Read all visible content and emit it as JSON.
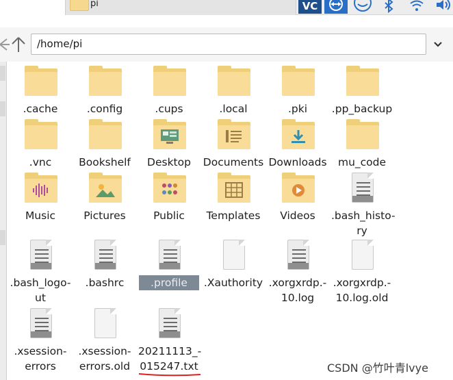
{
  "taskbar": {
    "window_label": "pi",
    "tray_icons": [
      "vnc-icon",
      "teamviewer-icon",
      "remote-icon",
      "bluetooth-icon",
      "wifi-icon",
      "volume-icon"
    ],
    "tray_text": "VC"
  },
  "toolbar": {
    "path": "/home/pi"
  },
  "items": [
    {
      "name": ".cache",
      "kind": "folder",
      "emblem": ""
    },
    {
      "name": ".config",
      "kind": "folder",
      "emblem": ""
    },
    {
      "name": ".cups",
      "kind": "folder",
      "emblem": ""
    },
    {
      "name": ".local",
      "kind": "folder",
      "emblem": ""
    },
    {
      "name": ".pki",
      "kind": "folder",
      "emblem": ""
    },
    {
      "name": ".pp_backup",
      "kind": "folder",
      "emblem": ""
    },
    {
      "name": ".vnc",
      "kind": "folder",
      "emblem": ""
    },
    {
      "name": "Bookshelf",
      "kind": "folder",
      "emblem": ""
    },
    {
      "name": "Desktop",
      "kind": "folder",
      "emblem": "desktop"
    },
    {
      "name": "Documents",
      "kind": "folder",
      "emblem": "documents"
    },
    {
      "name": "Downloads",
      "kind": "folder",
      "emblem": "downloads"
    },
    {
      "name": "mu_code",
      "kind": "folder",
      "emblem": ""
    },
    {
      "name": "Music",
      "kind": "folder",
      "emblem": "music"
    },
    {
      "name": "Pictures",
      "kind": "folder",
      "emblem": "pictures"
    },
    {
      "name": "Public",
      "kind": "folder",
      "emblem": "public"
    },
    {
      "name": "Templates",
      "kind": "folder",
      "emblem": "templates"
    },
    {
      "name": "Videos",
      "kind": "folder",
      "emblem": "videos"
    },
    {
      "name": ".bash_history",
      "label_lines": [
        ".bash_histo-",
        "ry"
      ],
      "kind": "text",
      "emblem": ""
    },
    {
      "name": ".bash_logout",
      "label_lines": [
        ".bash_logo-",
        "ut"
      ],
      "kind": "text",
      "emblem": ""
    },
    {
      "name": ".bashrc",
      "kind": "text",
      "emblem": ""
    },
    {
      "name": ".profile",
      "kind": "text",
      "emblem": "",
      "selected": true
    },
    {
      "name": ".Xauthority",
      "kind": "blank",
      "emblem": ""
    },
    {
      "name": ".xorgxrdp.10.log",
      "label_lines": [
        ".xorgxrdp.-",
        "10.log"
      ],
      "kind": "text",
      "emblem": ""
    },
    {
      "name": ".xorgxrdp.10.log.old",
      "label_lines": [
        ".xorgxrdp.-",
        "10.log.old"
      ],
      "kind": "blank",
      "emblem": ""
    },
    {
      "name": ".xsession-errors",
      "label_lines": [
        ".xsession-",
        "errors"
      ],
      "kind": "text",
      "emblem": ""
    },
    {
      "name": ".xsession-errors.old",
      "label_lines": [
        ".xsession-",
        "errors.old"
      ],
      "kind": "blank",
      "emblem": ""
    },
    {
      "name": "20211113_015247.txt",
      "label_lines": [
        "20211113_-",
        "015247.txt"
      ],
      "kind": "text",
      "emblem": ""
    }
  ],
  "watermark": "CSDN @竹叶青lvye",
  "colors": {
    "folder": "#f8dc97",
    "folder_back": "#f0cf7a",
    "selection": "#7d8a95",
    "underline": "#e02020"
  }
}
